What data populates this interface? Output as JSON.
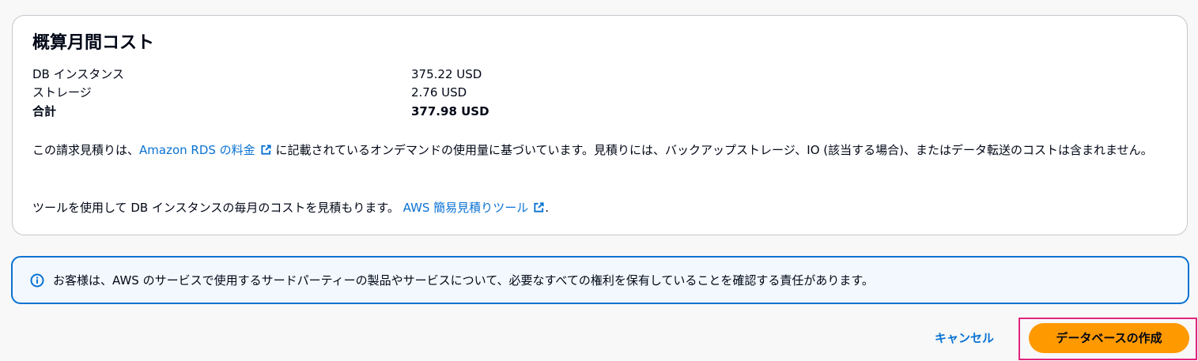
{
  "cost_panel": {
    "title": "概算月間コスト",
    "rows": [
      {
        "label": "DB インスタンス",
        "value": "375.22 USD"
      },
      {
        "label": "ストレージ",
        "value": "2.76 USD"
      },
      {
        "label": "合計",
        "value": "377.98 USD"
      }
    ],
    "estimate_note": {
      "prefix": "この請求見積りは、",
      "link_text": "Amazon RDS の料金",
      "suffix": "に記載されているオンデマンドの使用量に基づいています。見積りには、バックアップストレージ、IO (該当する場合)、またはデータ転送のコストは含まれません。"
    },
    "tool_note": {
      "prefix": "ツールを使用して DB インスタンスの毎月のコストを見積もります。",
      "link_text": "AWS 簡易見積りツール",
      "suffix": "."
    }
  },
  "info_alert": {
    "icon": "info-icon",
    "text": "お客様は、AWS のサービスで使用するサードパーティーの製品やサービスについて、必要なすべての権利を保有していることを確認する責任があります。"
  },
  "actions": {
    "cancel_label": "キャンセル",
    "create_label": "データベースの作成"
  },
  "colors": {
    "link": "#0972d3",
    "primary_button": "#ff9900",
    "highlight": "#e1257d",
    "info_border": "#0972d3",
    "info_background": "#f2f8fd"
  }
}
